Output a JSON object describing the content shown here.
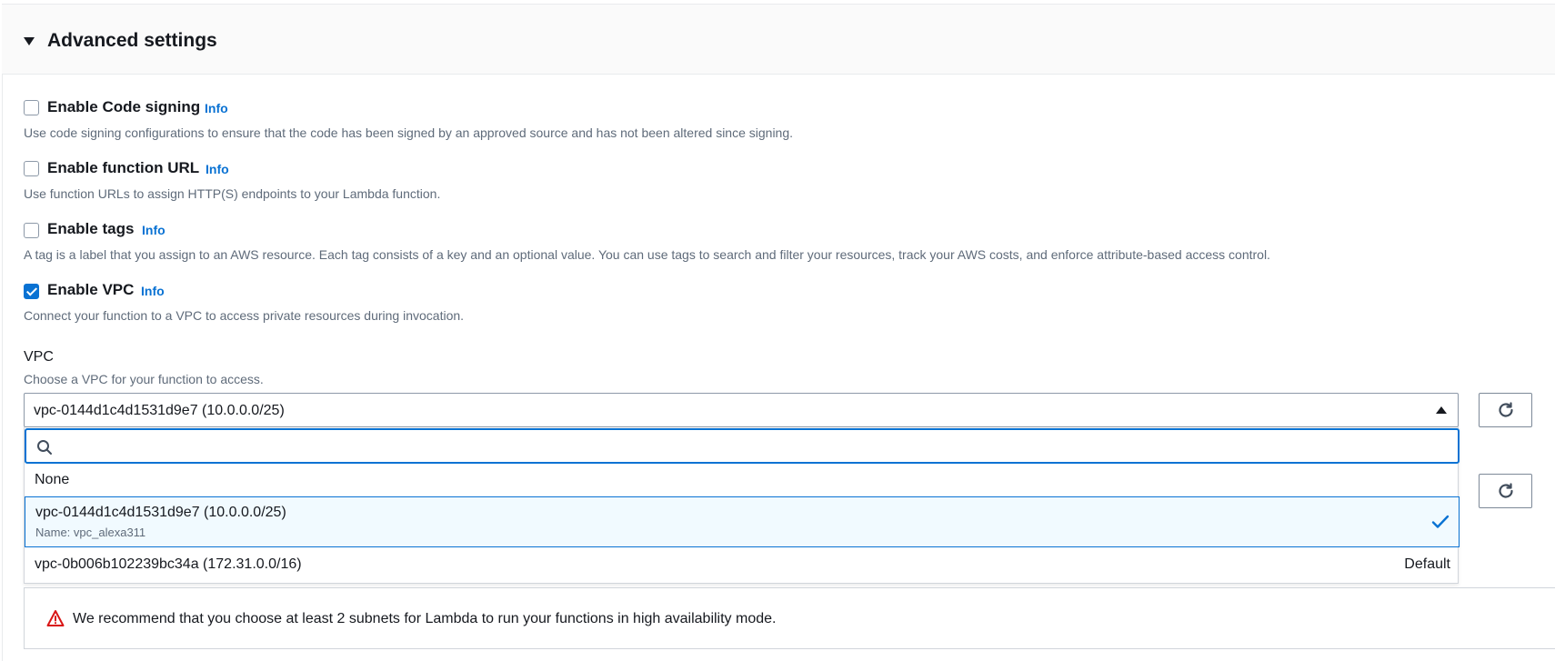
{
  "advanced": {
    "title": "Advanced settings",
    "options": [
      {
        "label": "Enable Code signing",
        "info": "Info",
        "checked": false,
        "description": "Use code signing configurations to ensure that the code has been signed by an approved source and has not been altered since signing."
      },
      {
        "label": "Enable function URL",
        "info": "Info",
        "checked": false,
        "description": "Use function URLs to assign HTTP(S) endpoints to your Lambda function."
      },
      {
        "label": "Enable tags",
        "info": "Info",
        "checked": false,
        "description": "A tag is a label that you assign to an AWS resource. Each tag consists of a key and an optional value. You can use tags to search and filter your resources, track your AWS costs, and enforce attribute-based access control."
      },
      {
        "label": "Enable VPC",
        "info": "Info",
        "checked": true,
        "description": "Connect your function to a VPC to access private resources during invocation."
      }
    ]
  },
  "vpc": {
    "label": "VPC",
    "description": "Choose a VPC for your function to access.",
    "selected_value": "vpc-0144d1c4d1531d9e7 (10.0.0.0/25)",
    "search_placeholder": "",
    "options": [
      {
        "label": "None"
      },
      {
        "label": "vpc-0144d1c4d1531d9e7 (10.0.0.0/25)",
        "sublabel": "Name: vpc_alexa311",
        "selected": true
      },
      {
        "label": "vpc-0b006b102239bc34a (172.31.0.0/16)",
        "tag": "Default"
      }
    ]
  },
  "alert": {
    "type": "warning",
    "message": "We recommend that you choose at least 2 subnets for Lambda to run your functions in high availability mode."
  },
  "colors": {
    "accent": "#0972d3",
    "warning": "#d91515",
    "selected_bg": "#f1faff"
  }
}
